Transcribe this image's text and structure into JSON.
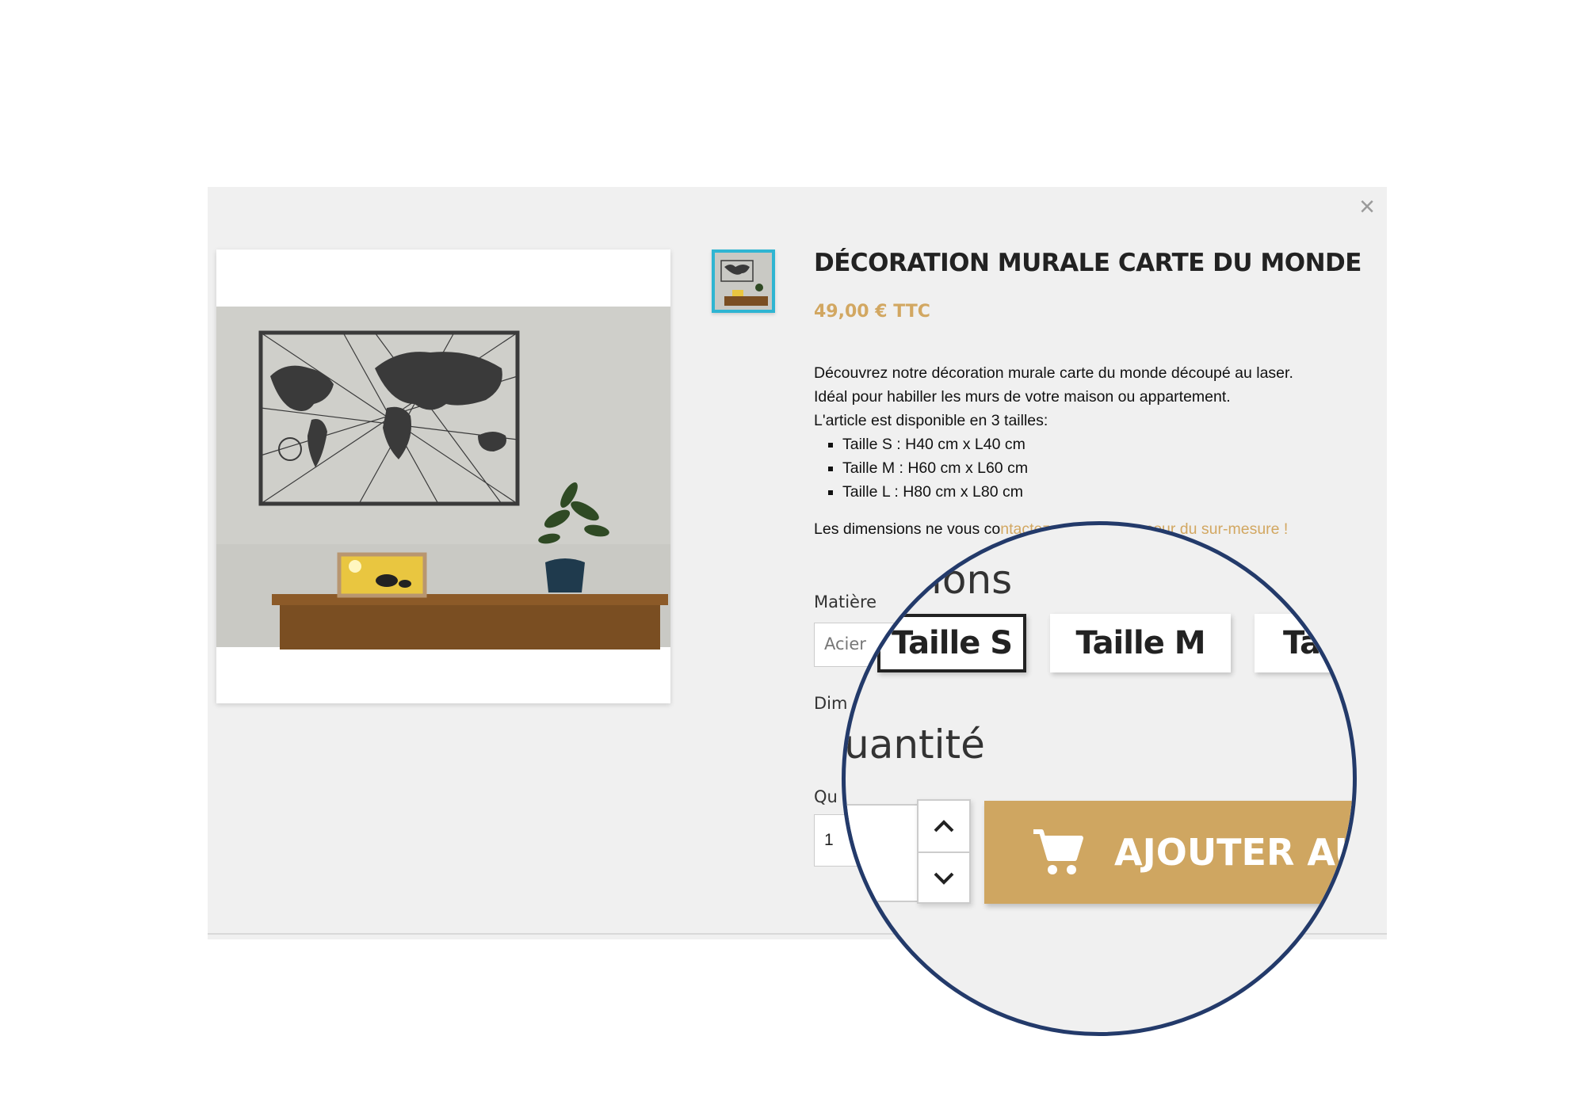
{
  "modal": {
    "close_label": "×"
  },
  "product": {
    "title": "DÉCORATION MURALE CARTE DU MONDE",
    "price": "49,00 € TTC",
    "description": {
      "line1": "Découvrez notre décoration murale carte du monde découpé au laser.",
      "line2": "Idéal pour habiller les murs de votre maison ou appartement.",
      "line3": "L'article est disponible en 3 tailles:",
      "sizes": [
        "Taille S : H40 cm x L40 cm",
        "Taille M : H60 cm x L60 cm",
        "Taille L : H80 cm x L80 cm"
      ],
      "note_prefix": "Les dimensions ne vous co",
      "note_link": "ntactez notre équipe pour du sur-mesure !"
    }
  },
  "form": {
    "material_label": "Matière",
    "material_value": "Acier",
    "dimension_label": "Dim",
    "quantity_label": "Qu",
    "quantity_value": "1"
  },
  "magnifier": {
    "heading1": "ions",
    "sizes": [
      "Taille S",
      "Taille M",
      "Ta"
    ],
    "selected_size": "Taille S",
    "heading2": "uantité",
    "add_to_cart": "AJOUTER AU"
  },
  "colors": {
    "accent": "#cfa661",
    "thumb_border": "#2fb5d2",
    "magnifier_ring": "#233a6a"
  }
}
